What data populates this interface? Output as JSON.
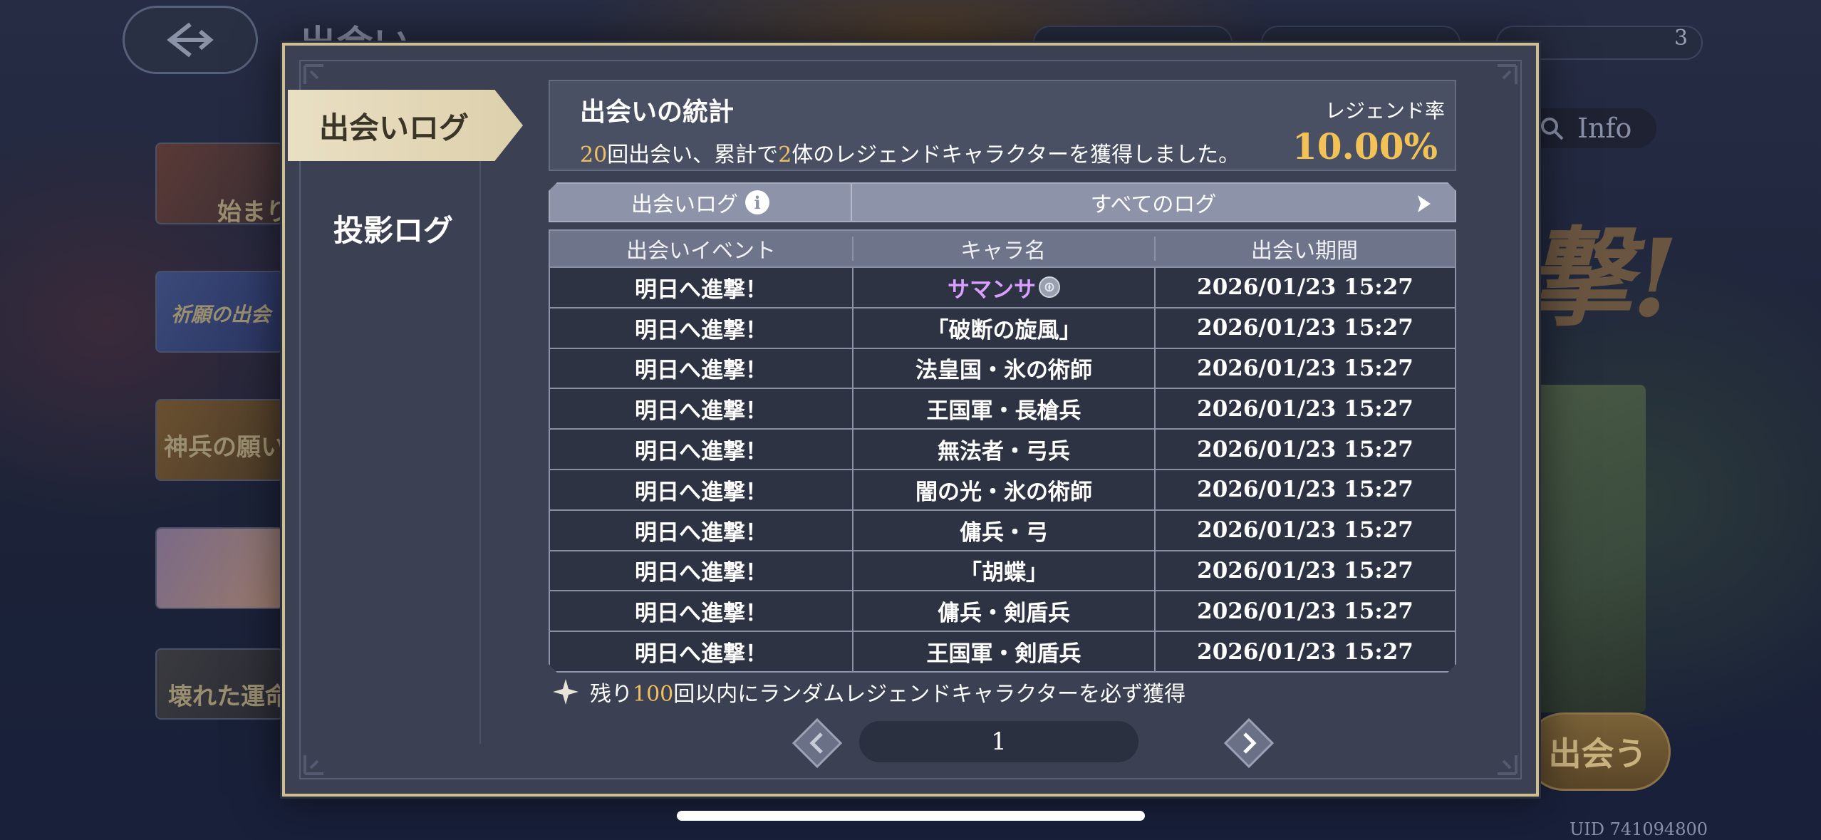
{
  "background": {
    "title_fragment": "出会い",
    "currency_count": "3",
    "info_label": "Info",
    "banner_text": "撃!",
    "cards": [
      {
        "label": "始まり"
      },
      {
        "label": "祈願の出会"
      },
      {
        "label": "神兵の願い"
      },
      {
        "label": ""
      },
      {
        "label": "壊れた運命"
      }
    ],
    "encounter_button": "出会う",
    "uid": "UID 741094800"
  },
  "modal": {
    "tabs": [
      {
        "label": "出会いログ",
        "active": true
      },
      {
        "label": "投影ログ",
        "active": false
      }
    ],
    "stats": {
      "title": "出会いの統計",
      "count_encounters": "20",
      "summary_mid": "回出会い、累計で",
      "count_legends": "2",
      "summary_end": "体のレジェンドキャラクターを獲得しました。",
      "legend_rate_label": "レジェンド率",
      "legend_rate_value": "10.00%"
    },
    "log_filter": {
      "left_label": "出会いログ",
      "info_icon": "i",
      "right_label": "すべてのログ"
    },
    "table": {
      "headers": [
        "出会いイベント",
        "キャラ名",
        "出会い期間"
      ],
      "rows": [
        {
          "event": "明日へ進撃！",
          "name": "サマンサ",
          "time": "2026/01/23 15:27",
          "legend": true
        },
        {
          "event": "明日へ進撃！",
          "name": "「破断の旋風」",
          "time": "2026/01/23 15:27"
        },
        {
          "event": "明日へ進撃！",
          "name": "法皇国・氷の術師",
          "time": "2026/01/23 15:27"
        },
        {
          "event": "明日へ進撃！",
          "name": "王国軍・長槍兵",
          "time": "2026/01/23 15:27"
        },
        {
          "event": "明日へ進撃！",
          "name": "無法者・弓兵",
          "time": "2026/01/23 15:27"
        },
        {
          "event": "明日へ進撃！",
          "name": "闇の光・氷の術師",
          "time": "2026/01/23 15:27"
        },
        {
          "event": "明日へ進撃！",
          "name": "傭兵・弓",
          "time": "2026/01/23 15:27"
        },
        {
          "event": "明日へ進撃！",
          "name": "「胡蝶」",
          "time": "2026/01/23 15:27"
        },
        {
          "event": "明日へ進撃！",
          "name": "傭兵・剣盾兵",
          "time": "2026/01/23 15:27"
        },
        {
          "event": "明日へ進撃！",
          "name": "王国軍・剣盾兵",
          "time": "2026/01/23 15:27"
        }
      ]
    },
    "guarantee": {
      "prefix": "残り",
      "count": "100",
      "suffix": "回以内にランダムレジェンドキャラクターを必ず獲得"
    },
    "pagination": {
      "page": "1"
    }
  },
  "colors": {
    "modal_bg": "#3b4053",
    "modal_border": "#cdbf92",
    "accent_gold": "#f2c257",
    "legend_name": "#d9a0ff"
  }
}
